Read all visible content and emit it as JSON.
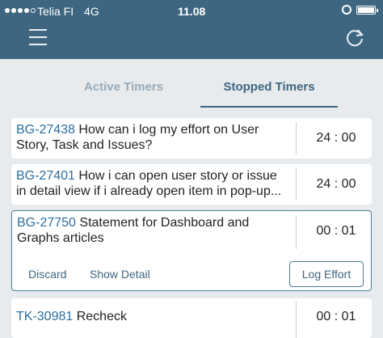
{
  "status_bar": {
    "carrier": "Telia FI",
    "network": "4G",
    "time": "11.08"
  },
  "header": {
    "menu_icon": "hamburger-icon",
    "refresh_icon": "refresh-icon"
  },
  "tabs": [
    {
      "label": "Active Timers",
      "selected": false
    },
    {
      "label": "Stopped Timers",
      "selected": true
    }
  ],
  "timers": [
    {
      "id": "BG-27438",
      "title": "How can i log my effort on User Story, Task and Issues?",
      "time": "24 : 00"
    },
    {
      "id": "BG-27401",
      "title": "How i can open user story or issue in detail view if i already open item in pop-up...",
      "time": "24 : 00"
    },
    {
      "id": "BG-27750",
      "title": "Statement for Dashboard and Graphs articles",
      "time": "00 : 01",
      "expanded": true,
      "actions": {
        "discard": "Discard",
        "show_detail": "Show Detail",
        "log_effort": "Log Effort"
      }
    },
    {
      "id": "TK-30981",
      "title": "Recheck",
      "time": "00 : 01"
    }
  ],
  "colors": {
    "header_bg": "#3f6680",
    "page_bg": "#e7ebee",
    "link": "#2c6ea0",
    "accent": "#3f6680"
  }
}
